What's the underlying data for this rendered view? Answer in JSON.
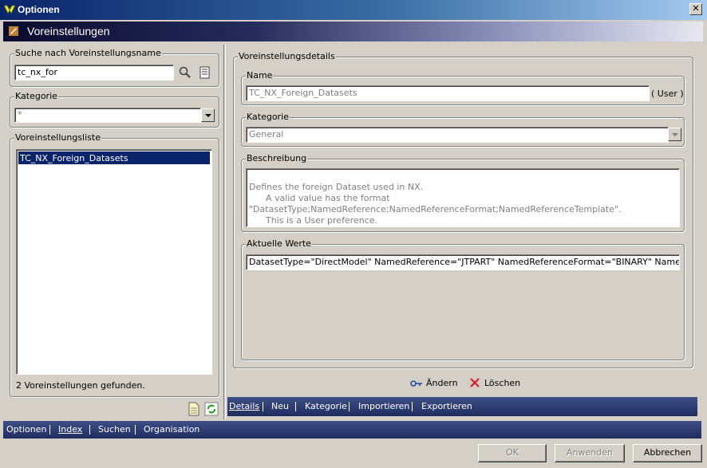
{
  "window": {
    "title": "Optionen",
    "close_glyph": "✕"
  },
  "header": {
    "title": "Voreinstellungen"
  },
  "left": {
    "search_group": "Suche nach Voreinstellungsname",
    "search_value": "tc_nx_for",
    "category_group": "Kategorie",
    "category_value": "*",
    "list_group": "Voreinstellungsliste",
    "list_items": [
      "TC_NX_Foreign_Datasets"
    ],
    "found_text": "2 Voreinstellungen gefunden."
  },
  "details": {
    "group": "Voreinstellungsdetails",
    "name_group": "Name",
    "name_value": "TC_NX_Foreign_Datasets",
    "scope": "( User )",
    "category_group": "Kategorie",
    "category_value": "General",
    "desc_group": "Beschreibung",
    "desc_lines": [
      "Defines the foreign Dataset used in NX.",
      "      A valid value has the format",
      "\"DatasetType;NamedReference;NamedReferenceFormat;NamedReferenceTemplate\".",
      "      This is a User preference."
    ],
    "values_group": "Aktuelle Werte",
    "current_value": "DatasetType=\"DirectModel\" NamedReference=\"JTPART\" NamedReferenceFormat=\"BINARY\" NamedReferenceTemplate=\"${UG_ITEM_ID}\"",
    "change_label": "Ändern",
    "delete_label": "Löschen"
  },
  "right_tabs": [
    "Details",
    "Neu",
    "Kategorie",
    "Importieren",
    "Exportieren"
  ],
  "bottom_tabs": [
    "Optionen",
    "Index",
    "Suchen",
    "Organisation"
  ],
  "buttons": {
    "ok": "OK",
    "apply": "Anwenden",
    "cancel": "Abbrechen"
  },
  "colors": {
    "selection": "#0a246a",
    "tabstrip": "#2a3a70"
  }
}
